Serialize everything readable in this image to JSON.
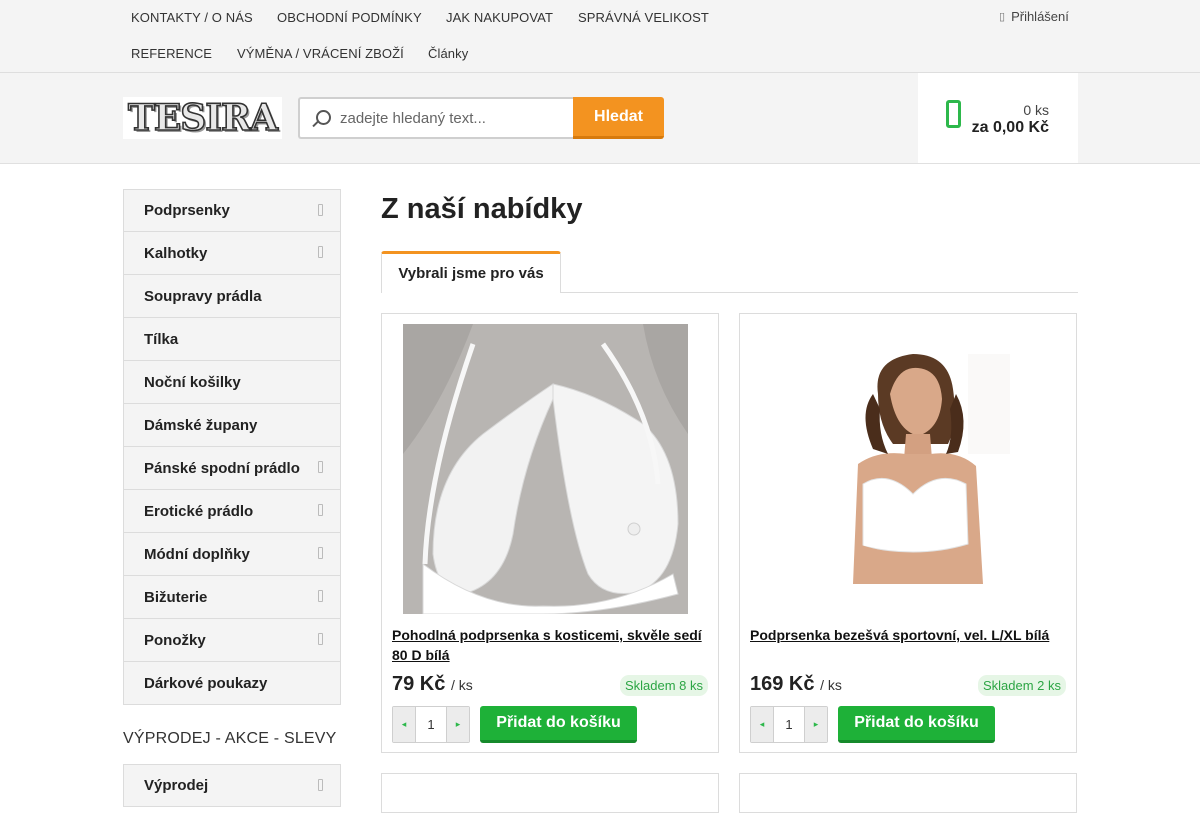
{
  "top_nav": {
    "row1": [
      "KONTAKTY / O NÁS",
      "OBCHODNÍ PODMÍNKY",
      "JAK NAKUPOVAT",
      "SPRÁVNÁ VELIKOST"
    ],
    "row2": [
      "REFERENCE",
      "VÝMĚNA / VRÁCENÍ ZBOŽÍ",
      "Články"
    ],
    "login": "Přihlášení"
  },
  "header": {
    "logo_text": "TESIRA",
    "search_placeholder": "zadejte hledaný text...",
    "search_button": "Hledat",
    "cart_qty": "0 ks",
    "cart_total": "za 0,00 Kč"
  },
  "sidebar": {
    "categories": [
      {
        "label": "Podprsenky",
        "has_sub": true
      },
      {
        "label": "Kalhotky",
        "has_sub": true
      },
      {
        "label": "Soupravy prádla",
        "has_sub": false
      },
      {
        "label": "Tílka",
        "has_sub": false
      },
      {
        "label": "Noční košilky",
        "has_sub": false
      },
      {
        "label": "Dámské župany",
        "has_sub": false
      },
      {
        "label": "Pánské spodní prádlo",
        "has_sub": true
      },
      {
        "label": "Erotické prádlo",
        "has_sub": true
      },
      {
        "label": "Módní doplňky",
        "has_sub": true
      },
      {
        "label": "Bižuterie",
        "has_sub": true
      },
      {
        "label": "Ponožky",
        "has_sub": true
      },
      {
        "label": "Dárkové poukazy",
        "has_sub": false
      }
    ],
    "section_title": "VÝPRODEJ - AKCE - SLEVY",
    "sale_categories": [
      {
        "label": "Výprodej",
        "has_sub": true
      }
    ]
  },
  "main": {
    "heading": "Z naší nabídky",
    "tab": "Vybrali jsme pro vás",
    "products": [
      {
        "title": "Pohodlná podprsenka s kosticemi, skvěle sedí 80 D bílá",
        "price": "79 Kč",
        "unit": "/ ks",
        "stock": "Skladem 8 ks",
        "quantity": "1",
        "add_button": "Přidat do košíku"
      },
      {
        "title": "Podprsenka bezešvá sportovní, vel. L/XL bílá",
        "price": "169 Kč",
        "unit": "/ ks",
        "stock": "Skladem 2 ks",
        "quantity": "1",
        "add_button": "Přidat do košíku"
      }
    ]
  },
  "colors": {
    "accent_orange": "#f39320",
    "accent_green": "#1eb138",
    "stock_green": "#2ca544"
  }
}
